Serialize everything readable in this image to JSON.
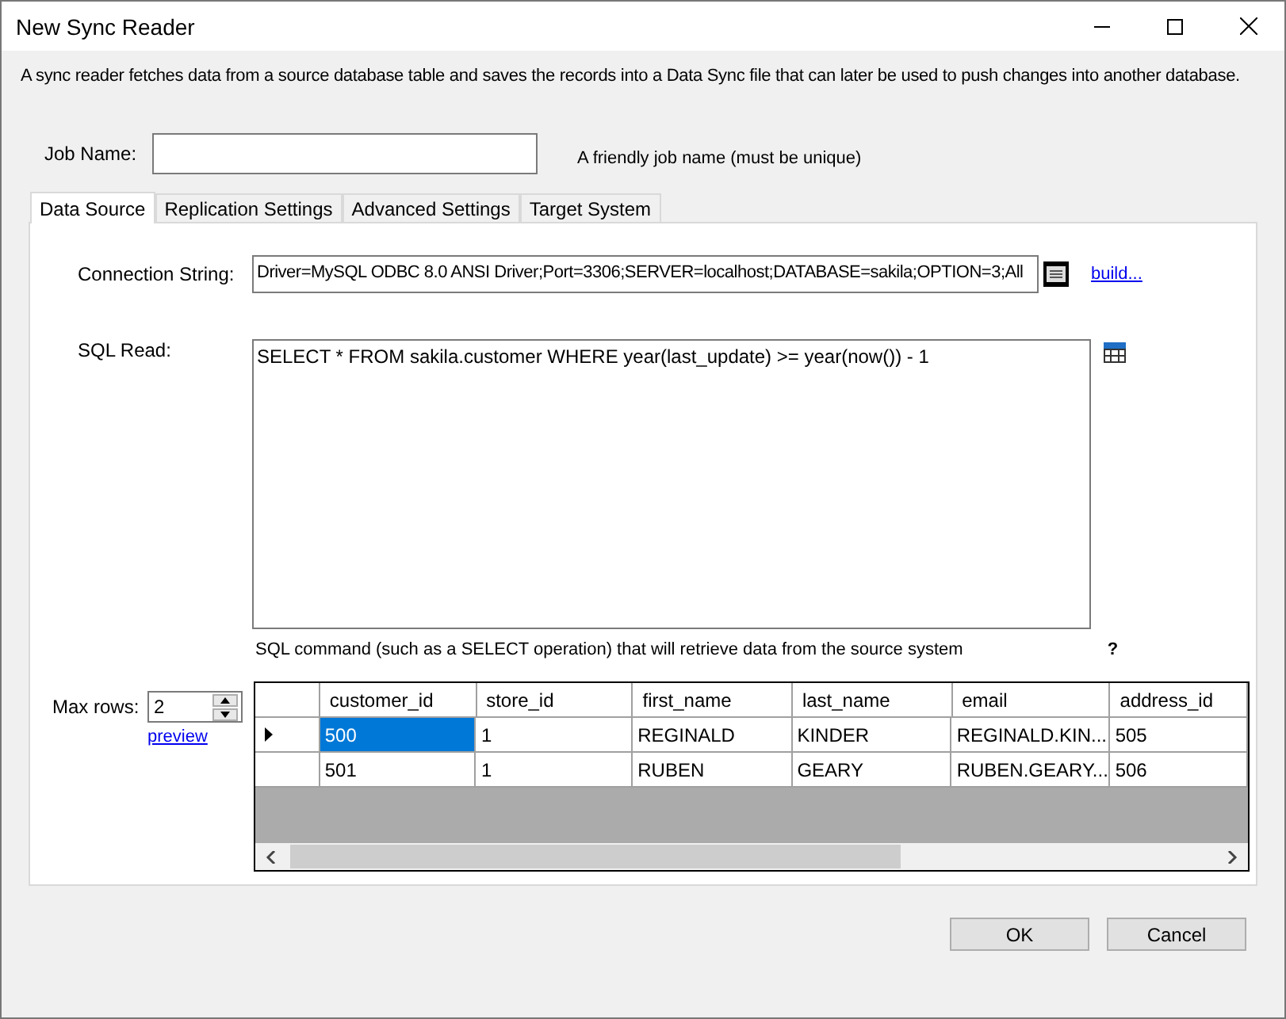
{
  "window": {
    "title": "New Sync Reader"
  },
  "description": "A sync reader fetches data from a source database table and saves the records into a Data Sync file that can later be used to push changes into another database.",
  "job_name": {
    "label": "Job Name:",
    "hint": "A friendly job name (must be unique)"
  },
  "tabs": [
    {
      "label": "Data Source",
      "selected": true
    },
    {
      "label": "Replication Settings",
      "selected": false
    },
    {
      "label": "Advanced Settings",
      "selected": false
    },
    {
      "label": "Target System",
      "selected": false
    }
  ],
  "connection_string": {
    "label": "Connection String:",
    "value": "Driver=MySQL ODBC 8.0 ANSI Driver;Port=3306;SERVER=localhost;DATABASE=sakila;OPTION=3;All",
    "link": "build..."
  },
  "sql_read": {
    "label": "SQL Read:",
    "value": "SELECT * FROM sakila.customer WHERE year(last_update) >= year(now()) - 1",
    "help": "SQL command (such as a SELECT operation) that will retrieve data from the source system",
    "help_mark": "?"
  },
  "max_rows": {
    "label": "Max rows:",
    "value": "2",
    "link": "preview"
  },
  "table": {
    "columns": [
      "customer_id",
      "store_id",
      "first_name",
      "last_name",
      "email",
      "address_id"
    ],
    "rows": [
      {
        "selected": true,
        "cells": [
          "500",
          "1",
          "REGINALD",
          "KINDER",
          "REGINALD.KIN...",
          "505"
        ]
      },
      {
        "selected": false,
        "cells": [
          "501",
          "1",
          "RUBEN",
          "GEARY",
          "RUBEN.GEARY...",
          "506"
        ]
      }
    ]
  },
  "buttons": [
    "OK",
    "Cancel"
  ]
}
